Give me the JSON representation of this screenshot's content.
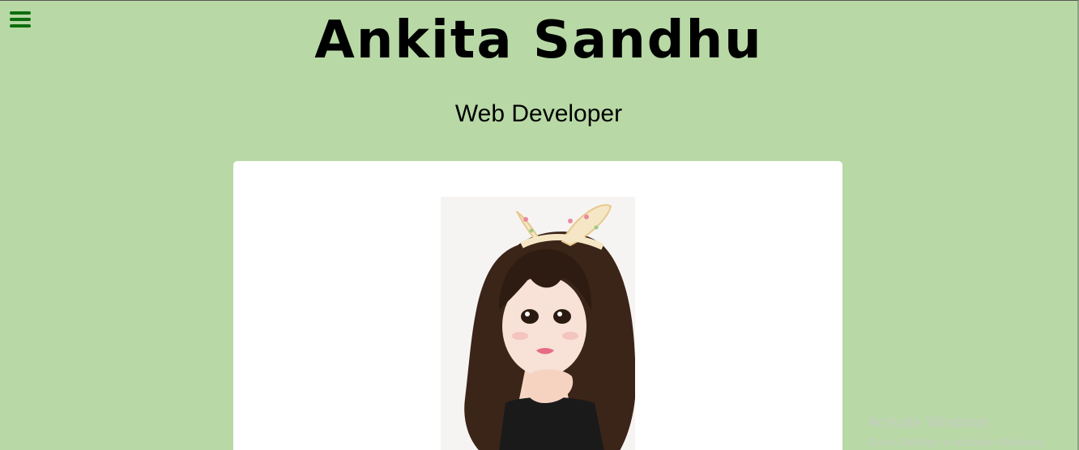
{
  "header": {
    "name": "Ankita Sandhu",
    "role": "Web Developer",
    "menu_icon": "hamburger-menu-icon",
    "accent_color": "#0e6d0e",
    "background_color": "#b8d9a6"
  },
  "profile": {
    "image_icon": "illustrated-girl-portrait"
  },
  "watermark": {
    "title": "Activate Windows",
    "subtitle": "Go to Settings to activate Windows."
  }
}
